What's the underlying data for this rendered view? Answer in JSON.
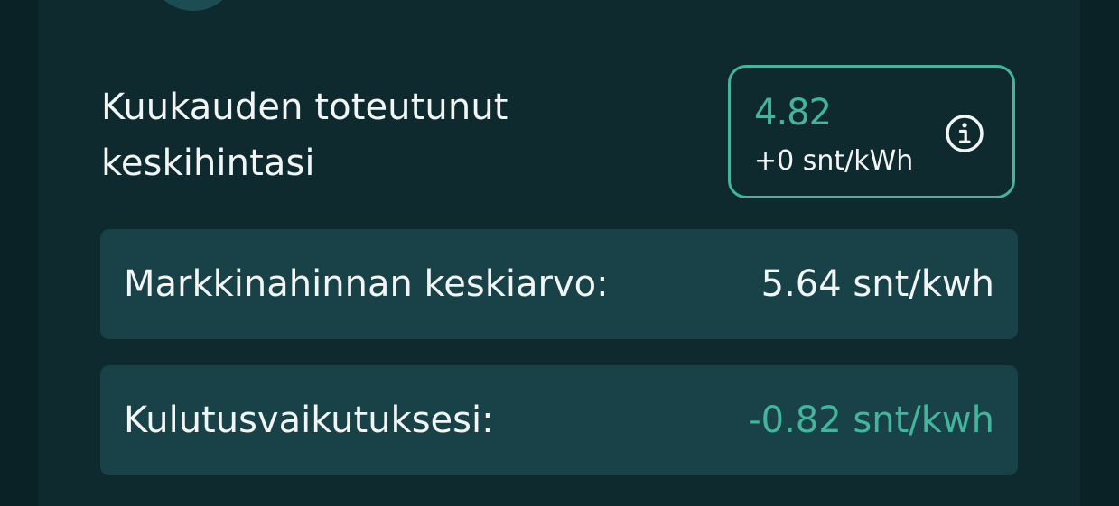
{
  "colors": {
    "page_background": "#0a2125",
    "card_background": "#0f2a2f",
    "row_background": "#184248",
    "accent": "#44b59c",
    "text": "#f1f5f4"
  },
  "summary": {
    "title": "Kuukauden toteutunut\nkeskihintasi",
    "average_price": "4.82",
    "price_change": "+0 snt/kWh",
    "info_icon": "info-icon"
  },
  "rows": [
    {
      "label": "Markkinahinnan keskiarvo:",
      "value": "5.64 snt/kwh"
    },
    {
      "label": "Kulutusvaikutuksesi:",
      "value": "-0.82 snt/kwh"
    }
  ]
}
